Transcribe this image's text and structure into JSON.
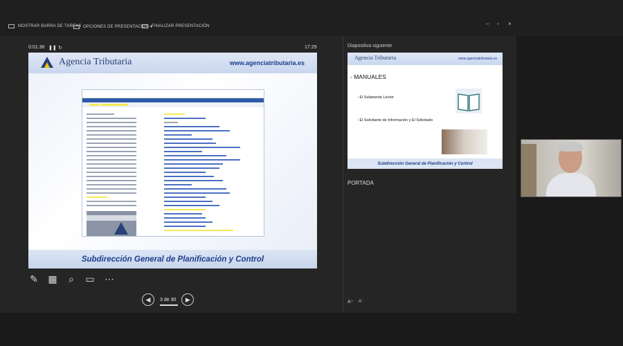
{
  "toolbar": {
    "show_taskbar": "MOSTRAR BARRA DE TAREAS",
    "presentation_options": "OPCIONES DE PRESENTACIÓN ▾",
    "end_presentation": "FINALIZAR PRESENTACIÓN"
  },
  "window_controls": {
    "minimize": "–",
    "restore": "▫",
    "close": "×"
  },
  "presenter": {
    "elapsed": "0:01:36",
    "clock": "17:29",
    "page_indicator": "3 de 30"
  },
  "current_slide": {
    "logo_text": "Agencia Tributaria",
    "url": "www.agenciatributaria.es",
    "footer": "Subdirección General de Planificación y Control"
  },
  "next_panel": {
    "label": "Diapositiva siguiente",
    "logo_text": "Agencia Tributaria",
    "url": "www.agenciatributaria.es",
    "title": "- MANUALES",
    "bullet1": "-   El Solamente Lector",
    "bullet2": "-   El Solicitante de Información y El Solicitado",
    "footer": "Subdirección General de Planificación y Control"
  },
  "notes": {
    "text": "PORTADA"
  },
  "font_controls": {
    "increase": "A",
    "decrease": "A"
  },
  "colors": {
    "brand_blue": "#1e3d8f",
    "highlight": "#f3ea53",
    "background": "#1a1a1a"
  },
  "icons": [
    "pen-icon",
    "slides-grid-icon",
    "zoom-icon",
    "screen-icon",
    "more-icon",
    "prev-icon",
    "next-icon",
    "pause-icon",
    "reset-icon"
  ]
}
